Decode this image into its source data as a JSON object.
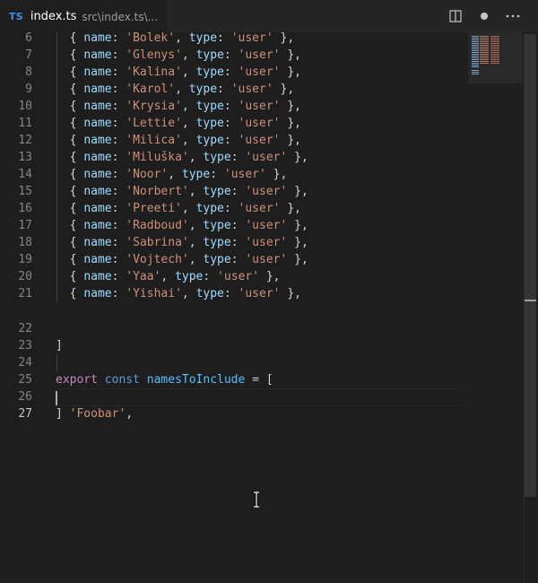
{
  "tab": {
    "badge": "TS",
    "filename": "index.ts",
    "path": "src\\index.ts\\..."
  },
  "editor_actions": [
    {
      "name": "split-editor-icon"
    },
    {
      "name": "unsaved-dot-icon"
    },
    {
      "name": "more-actions-icon"
    }
  ],
  "lines": [
    {
      "num": "6",
      "name": "Bolek"
    },
    {
      "num": "7",
      "name": "Glenys"
    },
    {
      "num": "8",
      "name": "Kalina"
    },
    {
      "num": "9",
      "name": "Karol"
    },
    {
      "num": "10",
      "name": "Krysia"
    },
    {
      "num": "11",
      "name": "Lettie"
    },
    {
      "num": "12",
      "name": "Milica"
    },
    {
      "num": "13",
      "name": "Miluška"
    },
    {
      "num": "14",
      "name": "Noor"
    },
    {
      "num": "15",
      "name": "Norbert"
    },
    {
      "num": "16",
      "name": "Preeti"
    },
    {
      "num": "17",
      "name": "Radboud"
    },
    {
      "num": "18",
      "name": "Sabrina"
    },
    {
      "num": "19",
      "name": "Vojtech"
    },
    {
      "num": "20",
      "name": "Yaa"
    },
    {
      "num": "21",
      "name": "Yishai"
    }
  ],
  "code_tokens": {
    "open_brace": "{ ",
    "prop_name": "name",
    "colon": ": ",
    "comma": ", ",
    "prop_type": "type",
    "type_value": "'user'",
    "close_brace": " },"
  },
  "tail": {
    "ln22": "22",
    "close_array": "]",
    "ln23": "23",
    "ln24": "24",
    "kw_export": "export",
    "kw_const": "const",
    "var_name": "namesToInclude",
    "assign": " = ",
    "open_array": "[",
    "ln25": "25",
    "foobar": "'Foobar'",
    "trail_comma": ",",
    "ln26": "26",
    "close_array2": "]",
    "ln27": "27"
  },
  "colors": {
    "background": "#1e1e1e",
    "property": "#9cdcfe",
    "string": "#ce9178",
    "keyword": "#c586c0",
    "storage": "#569cd6",
    "variable": "#4fc1ff",
    "line_number": "#858585"
  }
}
